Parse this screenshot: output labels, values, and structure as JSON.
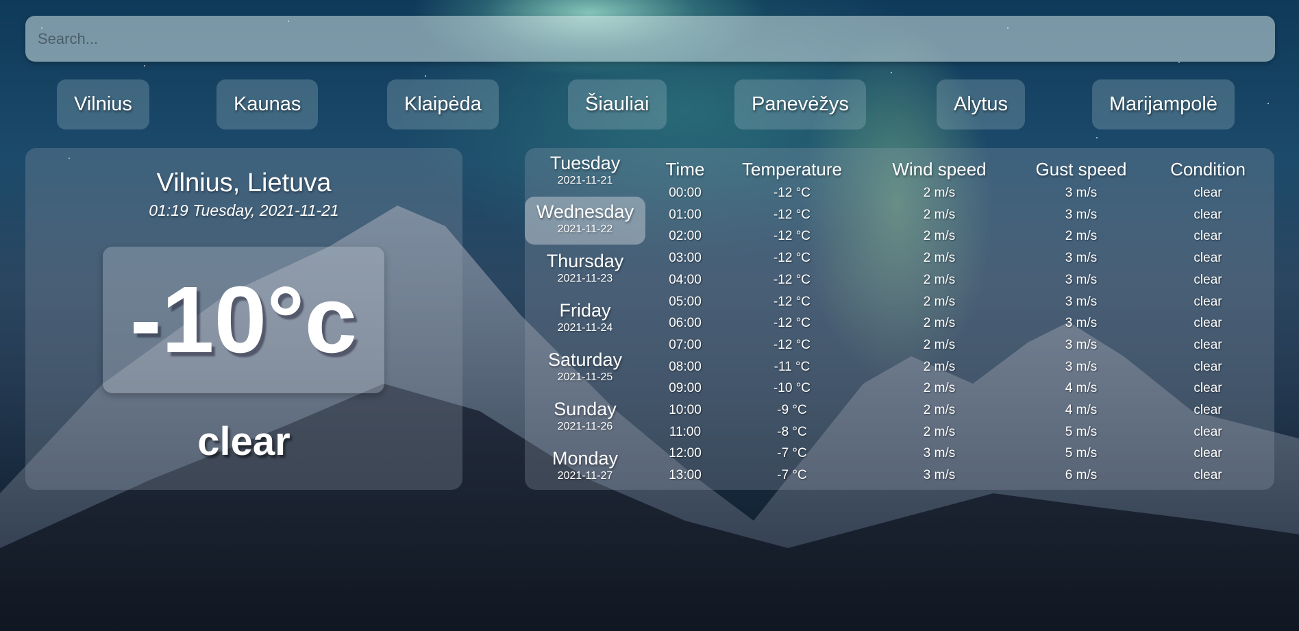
{
  "search": {
    "placeholder": "Search..."
  },
  "cities": [
    "Vilnius",
    "Kaunas",
    "Klaipėda",
    "Šiauliai",
    "Panevėžys",
    "Alytus",
    "Marijampolė"
  ],
  "current": {
    "location": "Vilnius, Lietuva",
    "datetime": "01:19 Tuesday, 2021-11-21",
    "temperature": "-10°c",
    "condition": "clear"
  },
  "forecast": {
    "days": [
      {
        "name": "Tuesday",
        "date": "2021-11-21",
        "active": false
      },
      {
        "name": "Wednesday",
        "date": "2021-11-22",
        "active": true
      },
      {
        "name": "Thursday",
        "date": "2021-11-23",
        "active": false
      },
      {
        "name": "Friday",
        "date": "2021-11-24",
        "active": false
      },
      {
        "name": "Saturday",
        "date": "2021-11-25",
        "active": false
      },
      {
        "name": "Sunday",
        "date": "2021-11-26",
        "active": false
      },
      {
        "name": "Monday",
        "date": "2021-11-27",
        "active": false
      }
    ],
    "columns": [
      "Time",
      "Temperature",
      "Wind speed",
      "Gust speed",
      "Condition"
    ],
    "rows": [
      [
        "00:00",
        "-12 °C",
        "2 m/s",
        "3 m/s",
        "clear"
      ],
      [
        "01:00",
        "-12 °C",
        "2 m/s",
        "3 m/s",
        "clear"
      ],
      [
        "02:00",
        "-12 °C",
        "2 m/s",
        "2 m/s",
        "clear"
      ],
      [
        "03:00",
        "-12 °C",
        "2 m/s",
        "3 m/s",
        "clear"
      ],
      [
        "04:00",
        "-12 °C",
        "2 m/s",
        "3 m/s",
        "clear"
      ],
      [
        "05:00",
        "-12 °C",
        "2 m/s",
        "3 m/s",
        "clear"
      ],
      [
        "06:00",
        "-12 °C",
        "2 m/s",
        "3 m/s",
        "clear"
      ],
      [
        "07:00",
        "-12 °C",
        "2 m/s",
        "3 m/s",
        "clear"
      ],
      [
        "08:00",
        "-11 °C",
        "2 m/s",
        "3 m/s",
        "clear"
      ],
      [
        "09:00",
        "-10 °C",
        "2 m/s",
        "4 m/s",
        "clear"
      ],
      [
        "10:00",
        "-9 °C",
        "2 m/s",
        "4 m/s",
        "clear"
      ],
      [
        "11:00",
        "-8 °C",
        "2 m/s",
        "5 m/s",
        "clear"
      ],
      [
        "12:00",
        "-7 °C",
        "3 m/s",
        "5 m/s",
        "clear"
      ],
      [
        "13:00",
        "-7 °C",
        "3 m/s",
        "6 m/s",
        "clear"
      ]
    ]
  }
}
